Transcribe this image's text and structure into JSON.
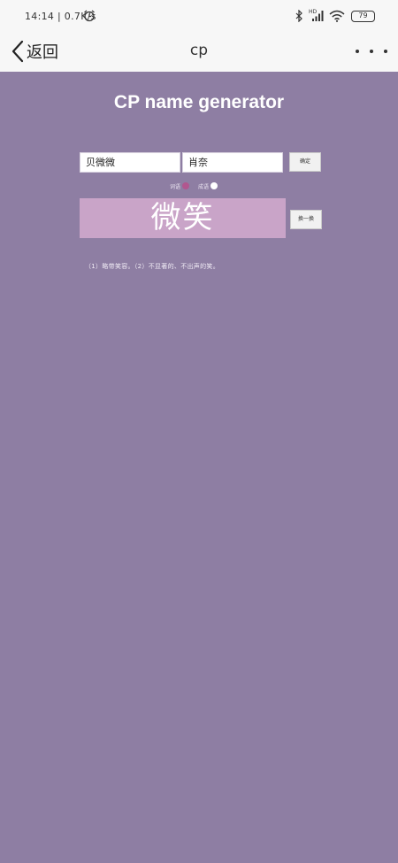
{
  "status_bar": {
    "time_speed": "14:14 | 0.7K/s",
    "icons": [
      "alarm-icon",
      "bluetooth-icon",
      "signal-icon",
      "wifi-icon",
      "battery-icon"
    ],
    "hd_label": "HD",
    "battery_level": "79"
  },
  "nav": {
    "back_label": "返回",
    "title": "cp",
    "more_icon": "more-dots-icon"
  },
  "page": {
    "heading": "CP name generator",
    "name1": "贝微微",
    "name2": "肖奈",
    "confirm_label": "确定",
    "options": [
      {
        "label": "词语",
        "selected": false
      },
      {
        "label": "成语",
        "selected": true
      }
    ],
    "result_word": "微笑",
    "next_label": "换一换",
    "definition": "（1）略带笑容。（2）不显著的、不出声的笑。"
  },
  "colors": {
    "background": "#8e7ea3",
    "result_box": "#c9a4c8",
    "radio_off": "#b1578f",
    "radio_on": "#ffffff",
    "bar": "#f7f7f7"
  }
}
